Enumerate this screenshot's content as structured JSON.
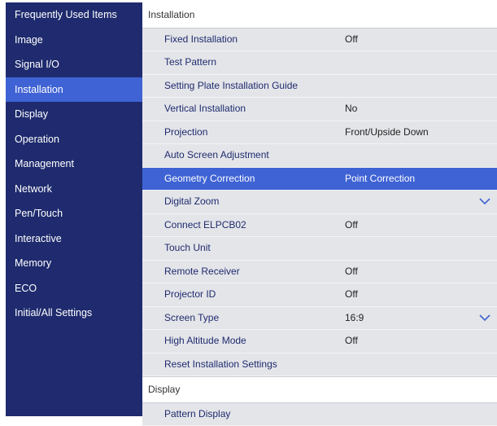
{
  "sidebar": {
    "items": [
      {
        "label": "Frequently Used Items"
      },
      {
        "label": "Image"
      },
      {
        "label": "Signal I/O"
      },
      {
        "label": "Installation",
        "active": true
      },
      {
        "label": "Display"
      },
      {
        "label": "Operation"
      },
      {
        "label": "Management"
      },
      {
        "label": "Network"
      },
      {
        "label": "Pen/Touch"
      },
      {
        "label": "Interactive"
      },
      {
        "label": "Memory"
      },
      {
        "label": "ECO"
      },
      {
        "label": "Initial/All Settings"
      }
    ]
  },
  "installation": {
    "header": "Installation",
    "rows": [
      {
        "label": "Fixed Installation",
        "value": "Off"
      },
      {
        "label": "Test Pattern",
        "value": ""
      },
      {
        "label": "Setting Plate Installation Guide",
        "value": ""
      },
      {
        "label": "Vertical Installation",
        "value": "No"
      },
      {
        "label": "Projection",
        "value": "Front/Upside Down"
      },
      {
        "label": "Auto Screen Adjustment",
        "value": ""
      },
      {
        "label": "Geometry Correction",
        "value": "Point Correction",
        "selected": true
      },
      {
        "label": "Digital Zoom",
        "value": "",
        "chevron": true
      },
      {
        "label": "Connect ELPCB02",
        "value": "Off"
      },
      {
        "label": "Touch Unit",
        "value": ""
      },
      {
        "label": "Remote Receiver",
        "value": "Off"
      },
      {
        "label": "Projector ID",
        "value": "Off"
      },
      {
        "label": "Screen Type",
        "value": "16:9",
        "chevron": true
      },
      {
        "label": "High Altitude Mode",
        "value": "Off"
      },
      {
        "label": "Reset Installation Settings",
        "value": ""
      }
    ]
  },
  "display": {
    "header": "Display",
    "rows": [
      {
        "label": "Pattern Display",
        "value": ""
      }
    ]
  },
  "colors": {
    "sidebar_bg": "#1f2b6e",
    "accent": "#3f63d4",
    "row_bg": "#e4e5e9",
    "row_text": "#1f2b6e"
  }
}
